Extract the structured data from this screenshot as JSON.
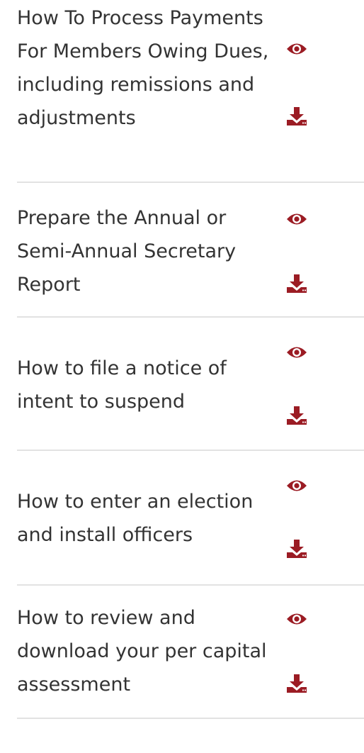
{
  "documents": [
    {
      "title": "How To Process Payments For Members Owing Dues, including remissions and adjustments",
      "view_icon": "eye-icon",
      "download_icon": "download-icon"
    },
    {
      "title": "Prepare the Annual or Semi-Annual Secretary Report",
      "view_icon": "eye-icon",
      "download_icon": "download-icon"
    },
    {
      "title": "How to file a notice of intent to suspend",
      "view_icon": "eye-icon",
      "download_icon": "download-icon"
    },
    {
      "title": "How to enter an election and install officers",
      "view_icon": "eye-icon",
      "download_icon": "download-icon"
    },
    {
      "title": "How to review and download your per capital assessment",
      "view_icon": "eye-icon",
      "download_icon": "download-icon"
    }
  ],
  "colors": {
    "icon": "#9b1c24",
    "text": "#333333",
    "divider": "#e2e2e2"
  }
}
